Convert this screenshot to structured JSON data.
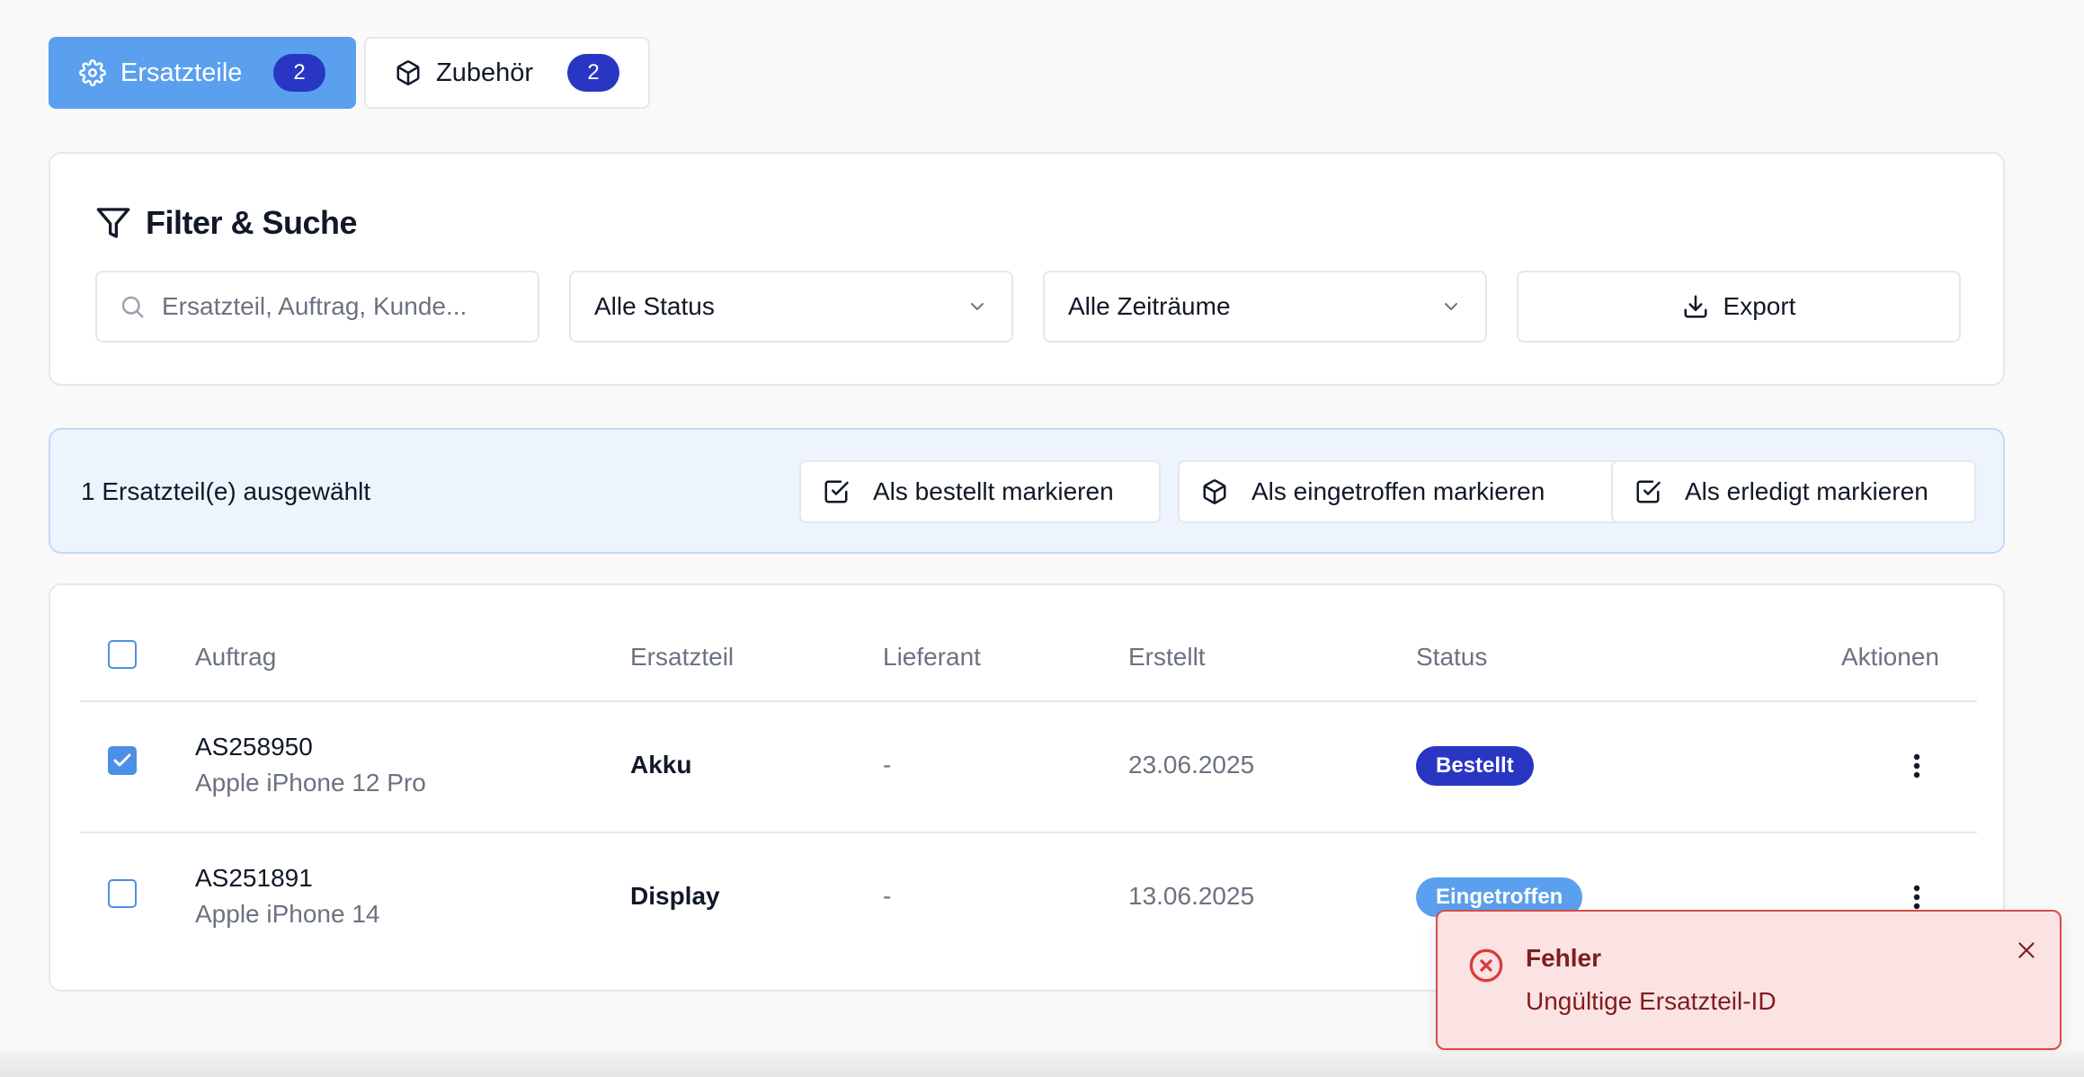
{
  "tabs": [
    {
      "label": "Ersatzteile",
      "count": "2",
      "icon": "gear-icon",
      "active": true
    },
    {
      "label": "Zubehör",
      "count": "2",
      "icon": "package-icon",
      "active": false
    }
  ],
  "filter": {
    "title": "Filter & Suche",
    "search_placeholder": "Ersatzteil, Auftrag, Kunde...",
    "status_select": "Alle Status",
    "period_select": "Alle Zeiträume",
    "export_label": "Export"
  },
  "bulk": {
    "selection_text": "1 Ersatzteil(e) ausgewählt",
    "actions": [
      {
        "label": "Als bestellt markieren",
        "icon": "checkbox-icon"
      },
      {
        "label": "Als eingetroffen markieren",
        "icon": "package-icon"
      },
      {
        "label": "Als erledigt markieren",
        "icon": "checkbox-icon"
      }
    ]
  },
  "table": {
    "columns": [
      "Auftrag",
      "Ersatzteil",
      "Lieferant",
      "Erstellt",
      "Status",
      "Aktionen"
    ],
    "rows": [
      {
        "checked": true,
        "order": "AS258950",
        "device": "Apple iPhone 12 Pro",
        "part": "Akku",
        "supplier": "-",
        "created": "23.06.2025",
        "status": "Bestellt",
        "status_color": "#2936c4"
      },
      {
        "checked": false,
        "order": "AS251891",
        "device": "Apple iPhone 14",
        "part": "Display",
        "supplier": "-",
        "created": "13.06.2025",
        "status": "Eingetroffen",
        "status_color": "#5aa0ef"
      }
    ]
  },
  "toast": {
    "title": "Fehler",
    "message": "Ungültige Ersatzteil-ID"
  },
  "colors": {
    "primary": "#5aa0ef",
    "badge_dark": "#2936c4",
    "error_bg": "#fbe3e3",
    "error_border": "#d84a4a"
  }
}
